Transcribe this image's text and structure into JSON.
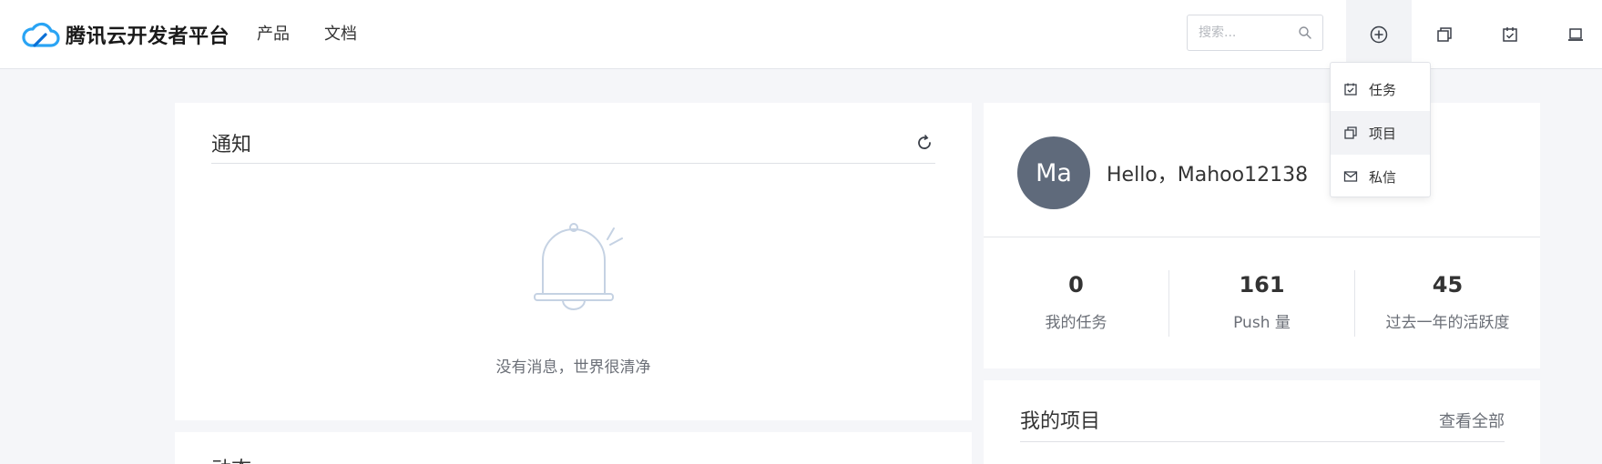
{
  "header": {
    "logo_text": "腾讯云开发者平台",
    "nav": [
      "产品",
      "文档"
    ],
    "search_placeholder": "搜索..."
  },
  "dropdown": {
    "items": [
      "任务",
      "项目",
      "私信"
    ]
  },
  "notice": {
    "title": "通知",
    "empty_text": "没有消息，世界很清净"
  },
  "activity": {
    "title": "动态"
  },
  "profile": {
    "avatar_initials": "Ma",
    "greeting": "Hello，Mahoo12138",
    "stats": [
      {
        "value": "0",
        "label": "我的任务"
      },
      {
        "value": "161",
        "label": "Push 量"
      },
      {
        "value": "45",
        "label": "过去一年的活跃度"
      }
    ]
  },
  "projects": {
    "title": "我的项目",
    "view_all": "查看全部"
  },
  "colors": {
    "accent": "#2aa4f4",
    "avatar_bg": "#5f6a7b"
  }
}
